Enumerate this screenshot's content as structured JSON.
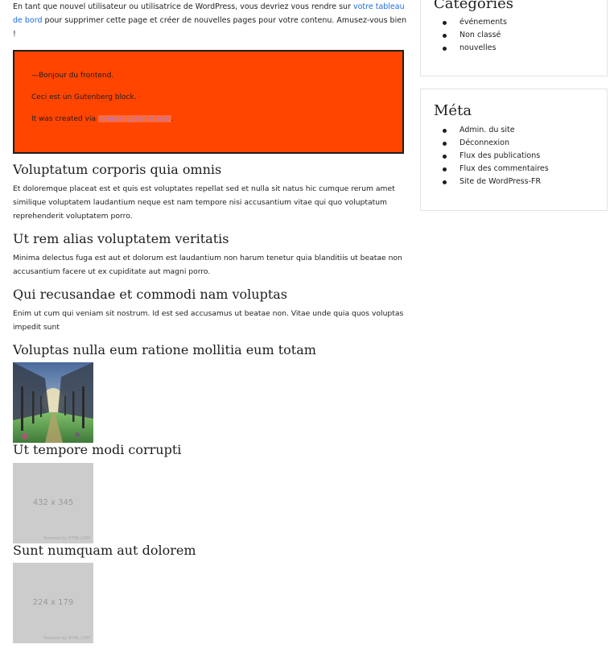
{
  "intro": {
    "text_before": "En tant que nouvel utilisateur ou utilisatrice de WordPress, vous devriez vous rendre sur ",
    "link": "votre tableau de bord",
    "text_after": " pour supprimer cette page et créer de nouvelles pages pour votre contenu. Amusez-vous bien !"
  },
  "gutenberg_block": {
    "line1": "—Bonjour du frontend.",
    "line2": "Ceci est un Gutenberg block.",
    "line3_prefix": "It was created via ",
    "line3_code": "create-guten-block",
    "line3_suffix": ".",
    "background": "#ff4500"
  },
  "posts": [
    {
      "title": "Voluptatum corporis quia omnis",
      "body": "Et doloremque placeat est et quis est voluptates repellat sed et nulla sit natus hic cumque rerum amet similique voluptatem laudantium neque est nam tempore nisi accusantium vitae qui quo voluptatum reprehenderit voluptatem porro."
    },
    {
      "title": "Ut rem alias voluptatem veritatis",
      "body": "Minima delectus fuga est aut et dolorum est laudantium non harum tenetur quia blanditiis ut beatae non accusantium facere ut ex cupiditate aut magni porro."
    },
    {
      "title": "Qui recusandae et commodi nam voluptas",
      "body": "Enim ut cum qui veniam sit nostrum. Id est sed accusamus ut beatae non. Vitae unde quia quos voluptas impedit sunt"
    },
    {
      "title": "Voluptas nulla eum ratione mollitia eum totam",
      "image": "tree-lined-path-photo"
    },
    {
      "title": "Ut tempore modi corrupti",
      "image_placeholder": "432 x 345",
      "powered_by": "Powered by HTML.COM"
    },
    {
      "title": "Sunt numquam aut dolorem",
      "image_placeholder": "224 x 179",
      "powered_by": "Powered by HTML.COM"
    }
  ],
  "sidebar": {
    "categories": {
      "title": "Catégories",
      "items": [
        "événements",
        "Non classé",
        "nouvelles"
      ]
    },
    "meta": {
      "title": "Méta",
      "items": [
        "Admin. du site",
        "Déconnexion",
        "Flux des publications",
        "Flux des commentaires",
        "Site de WordPress-FR"
      ]
    }
  }
}
